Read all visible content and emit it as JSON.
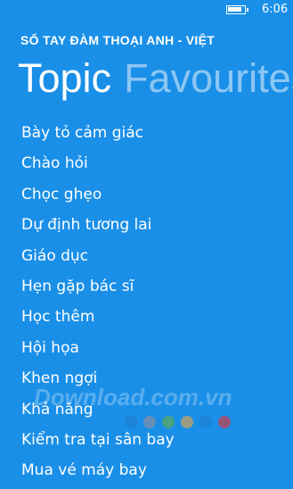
{
  "status_bar": {
    "time": "6:06",
    "battery_icon": "battery-icon"
  },
  "app": {
    "title": "SỔ TAY ĐÀM THOẠI ANH - VIỆT"
  },
  "pivot": {
    "tabs": [
      {
        "label": "Topic",
        "active": true
      },
      {
        "label": "Favourites",
        "active": false
      }
    ]
  },
  "topics": [
    "Bày tỏ cảm giác",
    "Chào hỏi",
    "Chọc ghẹo",
    "Dự định tương lai",
    "Giáo dục",
    "Hẹn gặp bác sĩ",
    "Học thêm",
    "Hội họa",
    "Khen ngợi",
    "Khả năng",
    "Kiểm tra tại sân bay",
    "Mua vé máy bay"
  ],
  "watermark": {
    "text": "Download.com.vn",
    "dot_colors": [
      "#1e7fd0",
      "#7f8fa8",
      "#5aa860",
      "#c8a060",
      "#1e7fd0",
      "#c04050"
    ]
  },
  "colors": {
    "background": "#1a8fe8",
    "text": "#ffffff",
    "inactive_tab": "#8cc6f3"
  }
}
